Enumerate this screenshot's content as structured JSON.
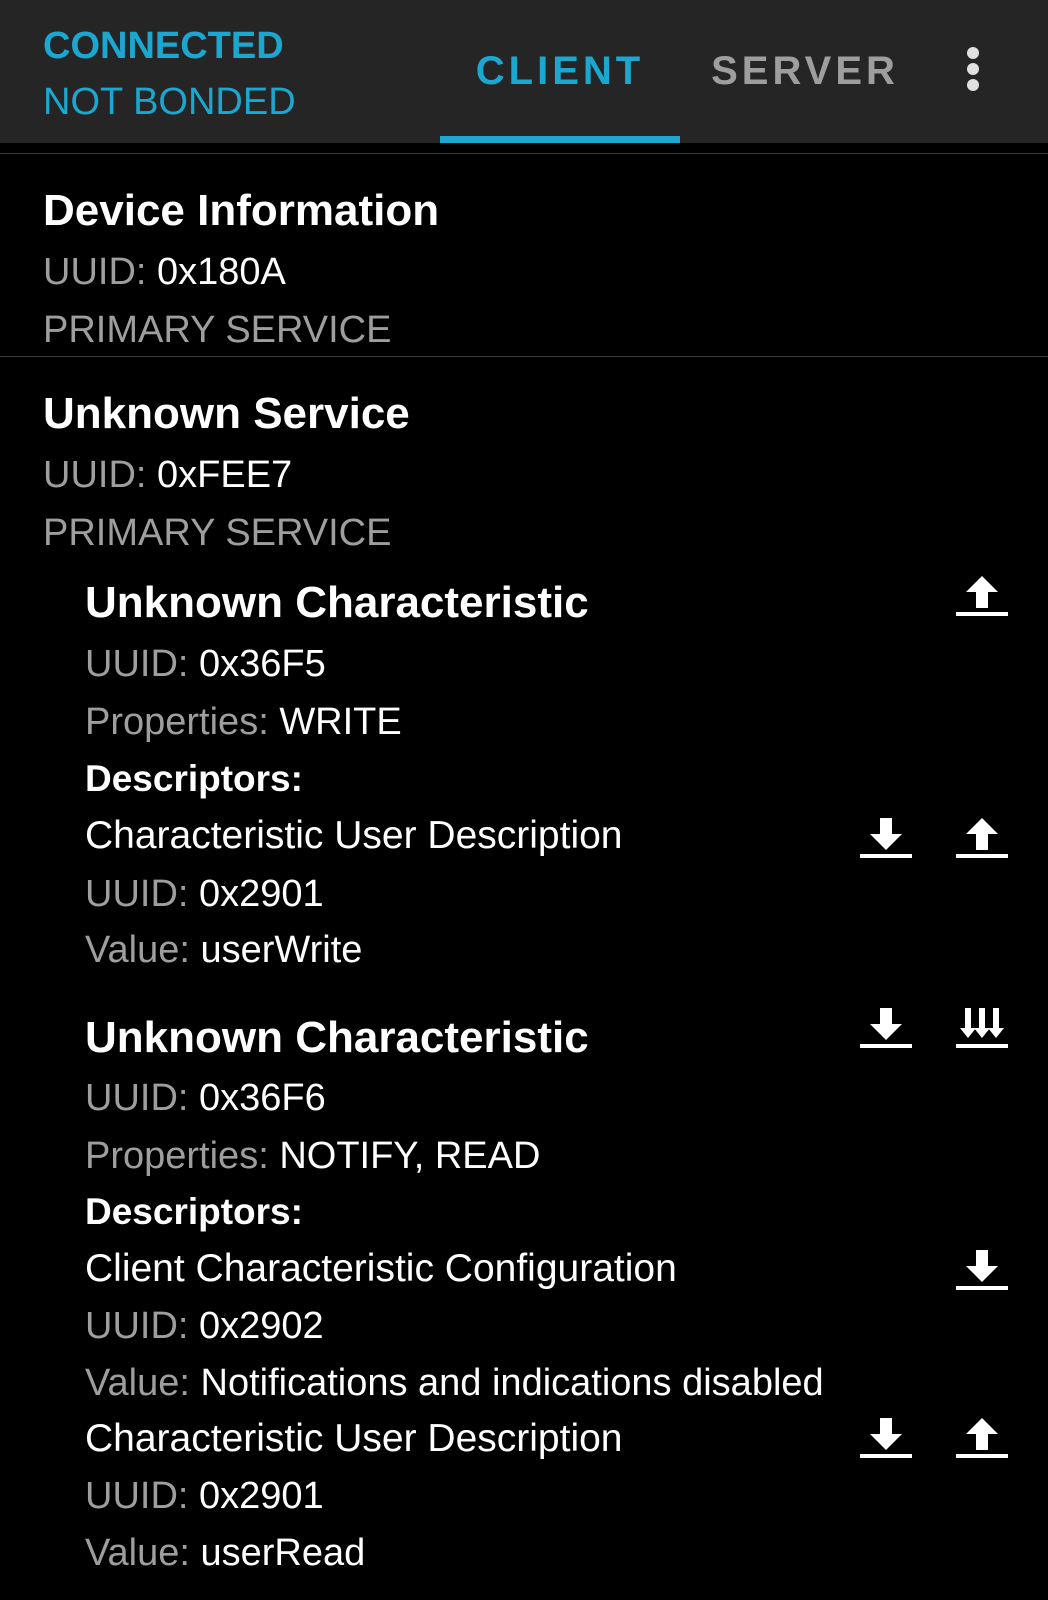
{
  "header": {
    "status_connection": "CONNECTED",
    "status_bond": "NOT BONDED",
    "tabs": [
      {
        "label": "CLIENT",
        "selected": true
      },
      {
        "label": "SERVER",
        "selected": false
      }
    ],
    "overflow_icon": "more-vert-icon"
  },
  "colors": {
    "accent": "#1ba7cf",
    "background": "#000000",
    "toolbar": "#252525",
    "secondary_text": "#9e9e9e"
  },
  "services": [
    {
      "name": "Device Information",
      "uuid_label": "UUID:",
      "uuid": "0x180A",
      "type": "PRIMARY SERVICE"
    },
    {
      "name": "Unknown Service",
      "uuid_label": "UUID:",
      "uuid": "0xFEE7",
      "type": "PRIMARY SERVICE",
      "characteristics": [
        {
          "name": "Unknown Characteristic",
          "uuid_label": "UUID:",
          "uuid": "0x36F5",
          "properties_label": "Properties:",
          "properties": "WRITE",
          "actions": [
            "write-icon"
          ],
          "descriptors_label": "Descriptors:",
          "descriptors": [
            {
              "name": "Characteristic User Description",
              "uuid_label": "UUID:",
              "uuid": "0x2901",
              "value_label": "Value:",
              "value": "userWrite",
              "actions": [
                "read-icon",
                "write-icon"
              ]
            }
          ]
        },
        {
          "name": "Unknown Characteristic",
          "uuid_label": "UUID:",
          "uuid": "0x36F6",
          "properties_label": "Properties:",
          "properties": "NOTIFY, READ",
          "actions": [
            "read-icon",
            "notify-icon"
          ],
          "descriptors_label": "Descriptors:",
          "descriptors": [
            {
              "name": "Client Characteristic Configuration",
              "uuid_label": "UUID:",
              "uuid": "0x2902",
              "value_label": "Value:",
              "value": "Notifications and indications disabled",
              "actions": [
                "read-icon"
              ]
            },
            {
              "name": "Characteristic User Description",
              "uuid_label": "UUID:",
              "uuid": "0x2901",
              "value_label": "Value:",
              "value": "userRead",
              "actions": [
                "read-icon",
                "write-icon"
              ]
            }
          ]
        }
      ]
    }
  ]
}
